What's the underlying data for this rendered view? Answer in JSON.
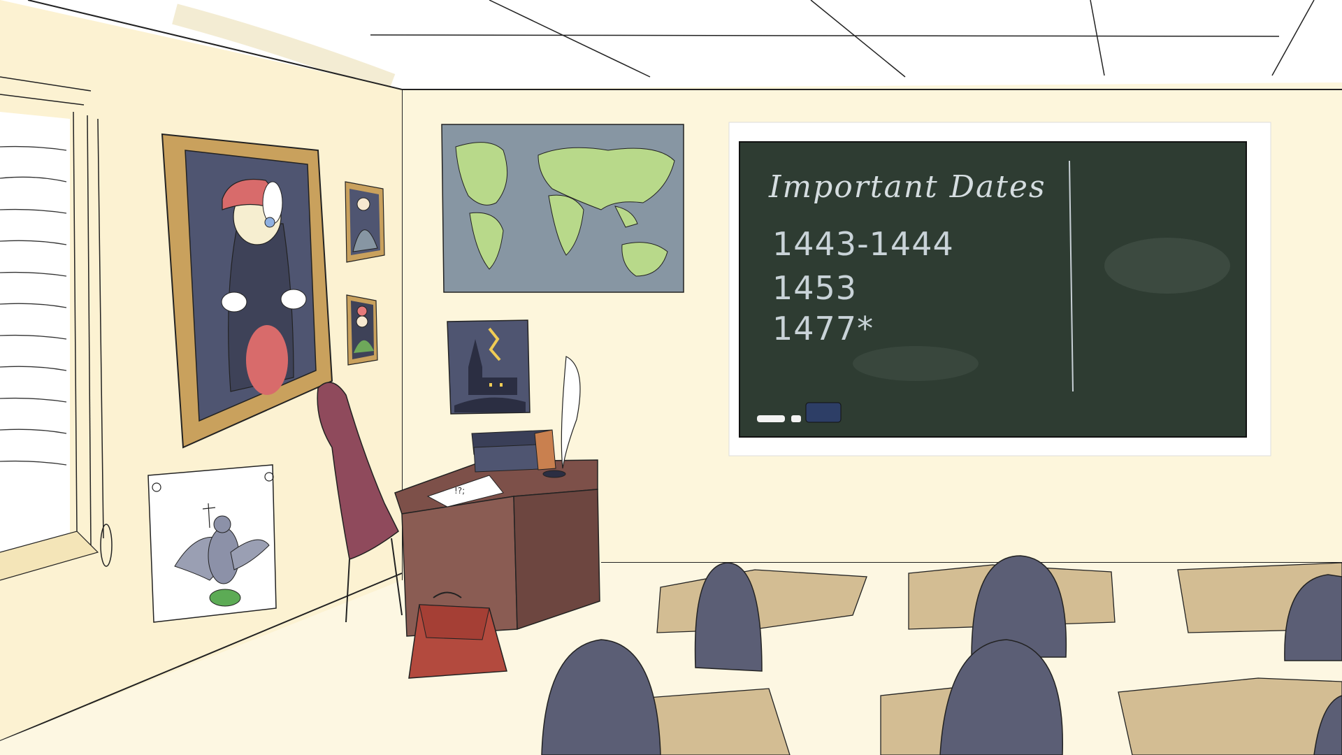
{
  "scene": {
    "name": "classroom",
    "colors": {
      "wall": "#fdf6dc",
      "ceiling": "#ffffff",
      "blackboard": "#2e3c32",
      "map_ocean": "#8796a3",
      "map_land": "#b8d98a",
      "desk_wood": "#8a5c53",
      "chair_seat": "#8f4a5c",
      "student_chairs": "#5b5e75",
      "student_desks": "#d3bd93",
      "bag": "#b34a3e",
      "painting_frame": "#c9a15d"
    }
  },
  "blackboard": {
    "heading": "Important Dates",
    "dates": [
      "1443-1444",
      "1453",
      "1477*"
    ]
  },
  "desk_paper": {
    "scribble": "!?;"
  }
}
